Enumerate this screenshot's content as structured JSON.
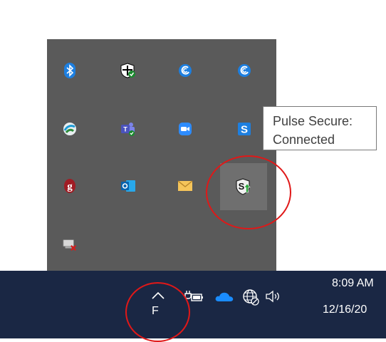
{
  "tooltip": {
    "line1": "Pulse Secure:",
    "line2": "Connected"
  },
  "tray_icons": [
    {
      "name": "bluetooth-icon"
    },
    {
      "name": "windows-security-icon"
    },
    {
      "name": "webex-icon"
    },
    {
      "name": "webex-icon-2"
    },
    {
      "name": "globe-network-app-icon"
    },
    {
      "name": "microsoft-teams-icon"
    },
    {
      "name": "zoom-icon"
    },
    {
      "name": "skype-for-business-icon"
    },
    {
      "name": "red-shield-app-icon"
    },
    {
      "name": "outlook-icon"
    },
    {
      "name": "mail-icon"
    },
    {
      "name": "pulse-secure-icon"
    },
    {
      "name": "network-error-icon"
    }
  ],
  "taskbar": {
    "overflow_label": "F",
    "time": "8:09 AM",
    "date": "12/16/20",
    "icons": [
      "chevron-up-icon",
      "power-plug-battery-icon",
      "onedrive-cloud-icon",
      "network-globe-icon",
      "volume-icon"
    ]
  },
  "colors": {
    "flyout_bg": "#5a5a5a",
    "taskbar_bg": "#1a2744",
    "highlight_circle": "#e01818",
    "tooltip_bg": "#ffffff"
  }
}
